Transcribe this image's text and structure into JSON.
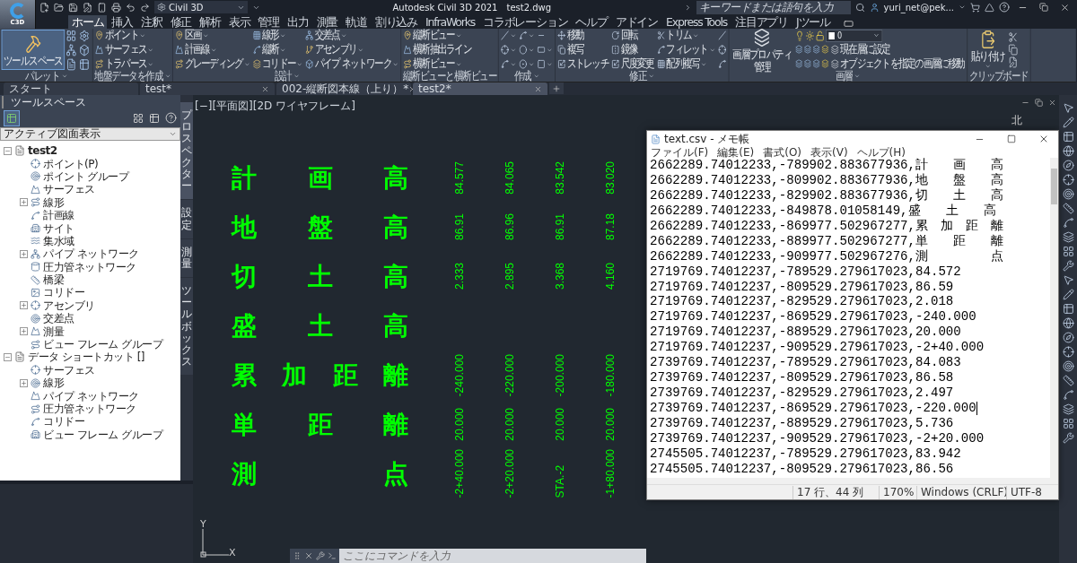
{
  "app": {
    "logo": "C3D",
    "workspace": "Civil 3D",
    "title": "Autodesk Civil 3D 2021",
    "file": "test2.dwg",
    "search": {
      "placeholder": "キーワードまたは語句を入力"
    },
    "user": "yuri_net@pek..."
  },
  "ribbon_tabs": [
    {
      "label": "ホーム",
      "selected": true
    },
    {
      "label": "挿入",
      "selected": false
    },
    {
      "label": "注釈",
      "selected": false
    },
    {
      "label": "修正",
      "selected": false
    },
    {
      "label": "解析",
      "selected": false
    },
    {
      "label": "表示",
      "selected": false
    },
    {
      "label": "管理",
      "selected": false
    },
    {
      "label": "出力",
      "selected": false
    },
    {
      "label": "測量",
      "selected": false
    },
    {
      "label": "軌道",
      "selected": false
    },
    {
      "label": "割り込み",
      "selected": false
    },
    {
      "label": "InfraWorks",
      "selected": false
    },
    {
      "label": "コラボレーション",
      "selected": false
    },
    {
      "label": "ヘルプ",
      "selected": false
    },
    {
      "label": "アドイン",
      "selected": false
    },
    {
      "label": "Express Tools",
      "selected": false
    },
    {
      "label": "注目アプリ",
      "selected": false
    },
    {
      "label": "Jツール",
      "selected": false
    }
  ],
  "ribbon_panels": [
    {
      "title": "パレット",
      "title_dropdown": true,
      "kind": "palette",
      "big": {
        "label": "ツールスペース",
        "on": true
      }
    },
    {
      "title": "地盤データを作成",
      "title_dropdown": true,
      "kind": "columns",
      "columns": [
        [
          {
            "label": "ポイント",
            "dropdown": true
          },
          {
            "label": "サーフェス",
            "dropdown": true
          },
          {
            "label": "トラバース",
            "dropdown": true
          }
        ]
      ]
    },
    {
      "title": "設計",
      "title_dropdown": true,
      "kind": "columns",
      "columns": [
        [
          {
            "label": "区画",
            "dropdown": true
          },
          {
            "label": "計画線",
            "dropdown": true
          },
          {
            "label": "グレーディング",
            "dropdown": true
          }
        ],
        [
          {
            "label": "線形",
            "dropdown": true
          },
          {
            "label": "縦断",
            "dropdown": true
          },
          {
            "label": "コリドー",
            "dropdown": true
          }
        ],
        [
          {
            "label": "交差点",
            "dropdown": true
          },
          {
            "label": "アセンブリ",
            "dropdown": true
          },
          {
            "label": "パイプ ネットワーク",
            "dropdown": true
          }
        ]
      ]
    },
    {
      "title": "縦断ビューと横断ビュー",
      "title_dropdown": false,
      "kind": "columns",
      "columns": [
        [
          {
            "label": "縦断ビュー",
            "dropdown": true
          },
          {
            "label": "横断抽出ライン",
            "dropdown": false
          },
          {
            "label": "横断ビュー",
            "dropdown": true
          }
        ]
      ]
    },
    {
      "title": "作成",
      "title_dropdown": true,
      "kind": "columns",
      "columns": [
        [
          {
            "dropdown": true
          },
          {
            "dropdown": true
          },
          {
            "dropdown": true
          }
        ],
        [
          {
            "dropdown": true
          },
          {
            "dropdown": true
          },
          {
            "dropdown": true
          }
        ],
        [
          {
            "dropdown": false
          },
          {
            "dropdown": true
          },
          {
            "dropdown": true
          }
        ]
      ]
    },
    {
      "title": "修正",
      "title_dropdown": true,
      "kind": "columns",
      "columns": [
        [
          {
            "label": "移動",
            "dropdown": false
          },
          {
            "label": "複写",
            "dropdown": false
          },
          {
            "label": "ストレッチ",
            "dropdown": false
          }
        ],
        [
          {
            "label": "回転",
            "dropdown": false
          },
          {
            "label": "鏡像",
            "dropdown": false
          },
          {
            "label": "尺度変更",
            "dropdown": false
          }
        ],
        [
          {
            "label": "トリム",
            "dropdown": true
          },
          {
            "label": "フィレット",
            "dropdown": true
          },
          {
            "label": "配列複写",
            "dropdown": true
          }
        ],
        [
          {
            "dropdown": false
          },
          {
            "dropdown": false
          },
          {
            "dropdown": false
          }
        ]
      ]
    },
    {
      "title": "画層",
      "title_dropdown": true,
      "kind": "layer",
      "big": {
        "lines": [
          "画層プロパティ",
          "管理"
        ]
      },
      "layer": "0",
      "actions": [
        "現在層に設定",
        "オブジェクトを指定の画層に移動"
      ]
    },
    {
      "title": "クリップボード",
      "title_dropdown": false,
      "kind": "clipboard",
      "big": {
        "label": "貼り付け",
        "dropdown": true
      }
    }
  ],
  "file_tabs": [
    {
      "label": "スタート",
      "selected": false,
      "closable": false
    },
    {
      "label": "test*",
      "selected": false,
      "closable": true
    },
    {
      "label": "002-縦断図本線（上り）*",
      "selected": false,
      "closable": true
    },
    {
      "label": "test2*",
      "selected": true,
      "closable": true
    }
  ],
  "toolspace": {
    "title": "ツールスペース",
    "view": "アクティブ図面表示",
    "tree": [
      {
        "label": "test2",
        "kind": "folder",
        "expanded": true,
        "children": [
          {
            "label": "ポイント(P)",
            "kind": "leaf"
          },
          {
            "label": "ポイント グループ",
            "kind": "leaf"
          },
          {
            "label": "サーフェス",
            "kind": "leaf"
          },
          {
            "label": "線形",
            "kind": "folder",
            "expanded": false
          },
          {
            "label": "計画線",
            "kind": "leaf"
          },
          {
            "label": "サイト",
            "kind": "leaf"
          },
          {
            "label": "集水域",
            "kind": "leaf"
          },
          {
            "label": "パイプ ネットワーク",
            "kind": "folder",
            "expanded": false
          },
          {
            "label": "圧力管ネットワーク",
            "kind": "leaf"
          },
          {
            "label": "橋梁",
            "kind": "leaf"
          },
          {
            "label": "コリドー",
            "kind": "leaf"
          },
          {
            "label": "アセンブリ",
            "kind": "folder",
            "expanded": false
          },
          {
            "label": "交差点",
            "kind": "leaf"
          },
          {
            "label": "測量",
            "kind": "folder",
            "expanded": false
          },
          {
            "label": "ビュー フレーム グループ",
            "kind": "leaf"
          }
        ]
      },
      {
        "label": "データ ショートカット []",
        "kind": "folder",
        "expanded": true,
        "children": [
          {
            "label": "サーフェス",
            "kind": "leaf"
          },
          {
            "label": "線形",
            "kind": "folder",
            "expanded": false
          },
          {
            "label": "パイプ ネットワーク",
            "kind": "leaf"
          },
          {
            "label": "圧力管ネットワーク",
            "kind": "leaf"
          },
          {
            "label": "コリドー",
            "kind": "leaf"
          },
          {
            "label": "ビュー フレーム グループ",
            "kind": "leaf"
          }
        ]
      }
    ],
    "side_tabs": [
      {
        "label": "プロスペクター",
        "selected": true
      },
      {
        "label": "設定",
        "selected": false
      },
      {
        "label": "測量",
        "selected": false
      },
      {
        "label": "ツールボックス",
        "selected": false
      }
    ]
  },
  "drawing": {
    "viewport": "[−][平面図][2D ワイヤフレーム]",
    "compass": "北",
    "axis_x": "X",
    "axis_y": "Y",
    "rows": [
      {
        "chars": [
          "計",
          "画",
          "高"
        ],
        "values": [
          "84.577",
          "84.065",
          "83.542",
          "83.020"
        ]
      },
      {
        "chars": [
          "地",
          "盤",
          "高"
        ],
        "values": [
          "86.91",
          "86.96",
          "86.91",
          "87.18"
        ]
      },
      {
        "chars": [
          "切",
          "土",
          "高"
        ],
        "values": [
          "2.333",
          "2.895",
          "3.368",
          "4.160"
        ]
      },
      {
        "chars": [
          "盛",
          "土",
          "高"
        ]
      },
      {
        "chars": [
          "累",
          "加",
          "距",
          "離"
        ],
        "values": [
          "-240.000",
          "-220.000",
          "-200.000",
          "-180.000"
        ]
      },
      {
        "chars": [
          "単",
          "距",
          "離"
        ],
        "values": [
          "20.000",
          "20.000",
          "20.000",
          "20.000"
        ]
      },
      {
        "chars": [
          "測",
          "点"
        ],
        "values": [
          "-2+40.000",
          "-2+20.000",
          "STA.-2",
          "-1+80.000"
        ]
      }
    ]
  },
  "command_line": {
    "placeholder": "ここにコマンドを入力"
  },
  "notepad": {
    "title": "text.csv - メモ帳",
    "menu": [
      "ファイル(F)",
      "編集(E)",
      "書式(O)",
      "表示(V)",
      "ヘルプ(H)"
    ],
    "lines": [
      {
        "text": "2662289.74012233,-789902.883677936,計　　画　　高",
        "cursor": false
      },
      {
        "text": "2662289.74012233,-809902.883677936,地　　盤　　高",
        "cursor": false
      },
      {
        "text": "2662289.74012233,-829902.883677936,切　　土　　高",
        "cursor": false
      },
      {
        "text": "2662289.74012233,-849878.01058149,盛　　土　　高",
        "cursor": false
      },
      {
        "text": "2662289.74012233,-869977.502967277,累　加　距　離",
        "cursor": false
      },
      {
        "text": "2662289.74012233,-889977.502967277,単　　距　　離",
        "cursor": false
      },
      {
        "text": "2662289.74012233,-909977.502967276,測　　　　　点",
        "cursor": false
      },
      {
        "text": "2719769.74012237,-789529.279617023,84.572",
        "cursor": false
      },
      {
        "text": "2719769.74012237,-809529.279617023,86.59",
        "cursor": false
      },
      {
        "text": "2719769.74012237,-829529.279617023,2.018",
        "cursor": false
      },
      {
        "text": "2719769.74012237,-869529.279617023,-240.000",
        "cursor": false
      },
      {
        "text": "2719769.74012237,-889529.279617023,20.000",
        "cursor": false
      },
      {
        "text": "2719769.74012237,-909529.279617023,-2+40.000",
        "cursor": false
      },
      {
        "text": "2739769.74012237,-789529.279617023,84.083",
        "cursor": false
      },
      {
        "text": "2739769.74012237,-809529.279617023,86.58",
        "cursor": false
      },
      {
        "text": "2739769.74012237,-829529.279617023,2.497",
        "cursor": false
      },
      {
        "text": "2739769.74012237,-869529.279617023,-220.000",
        "cursor": true
      },
      {
        "text": "2739769.74012237,-889529.279617023,5.736",
        "cursor": false
      },
      {
        "text": "2739769.74012237,-909529.279617023,-2+20.000",
        "cursor": false
      },
      {
        "text": "2745505.74012237,-789529.279617023,83.942",
        "cursor": false
      },
      {
        "text": "2745505.74012237,-809529.279617023,86.56",
        "cursor": false
      }
    ],
    "status": [
      "17 行、44 列",
      "170%",
      "Windows (CRLF)",
      "UTF-8"
    ]
  }
}
